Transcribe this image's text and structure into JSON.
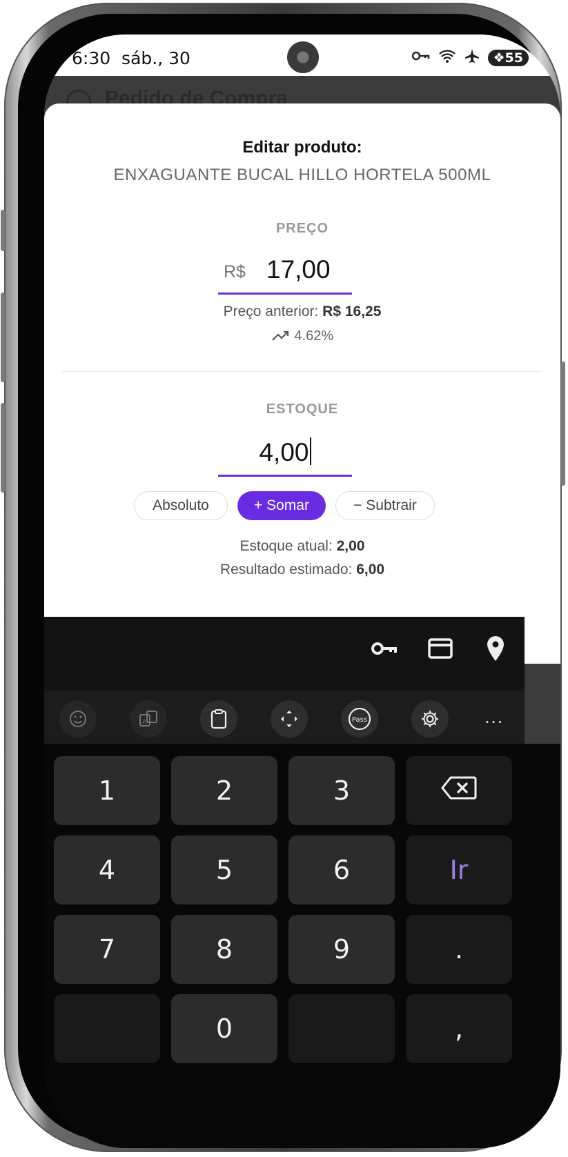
{
  "status_bar": {
    "time": "6:30",
    "date": "sáb., 30",
    "battery": "55",
    "icons": [
      "key-icon",
      "wifi-icon",
      "airplane-icon",
      "battery-saver-icon"
    ]
  },
  "app_bar": {
    "title": "Pedido de Compra"
  },
  "sheet": {
    "heading": "Editar produto:",
    "product_name": "ENXAGUANTE BUCAL HILLO HORTELA 500ML",
    "price": {
      "label": "PREÇO",
      "currency": "R$",
      "value": "17,00",
      "previous_label": "Preço anterior:",
      "previous_value": "R$ 16,25",
      "change_percent": "4.62%"
    },
    "stock": {
      "label": "ESTOQUE",
      "value": "4,00",
      "modes": [
        "Absoluto",
        "+ Somar",
        "− Subtrair"
      ],
      "selected_mode": "+ Somar",
      "current_label": "Estoque atual:",
      "current_value": "2,00",
      "estimated_label": "Resultado estimado:",
      "estimated_value": "6,00"
    }
  },
  "keyboard": {
    "autofill_icons": [
      "key-icon",
      "card-icon",
      "location-pin-icon"
    ],
    "toolbar_icons": [
      "emoji-icon",
      "translate-icon",
      "clipboard-icon",
      "text-cursor-icon",
      "pass-icon",
      "settings-icon",
      "more-icon"
    ],
    "pass_label": "Pass",
    "more": "...",
    "keys": {
      "k1": "1",
      "k2": "2",
      "k3": "3",
      "k4": "4",
      "k5": "5",
      "k6": "6",
      "k7": "7",
      "k8": "8",
      "k9": "9",
      "k0": "0",
      "go": "Ir",
      "dot": ".",
      "comma": ","
    }
  },
  "colors": {
    "accent": "#6a2ce0",
    "keyboard_bg": "#080808",
    "key_bg": "#2c2c2c",
    "go_key_text": "#9a7fe0"
  }
}
